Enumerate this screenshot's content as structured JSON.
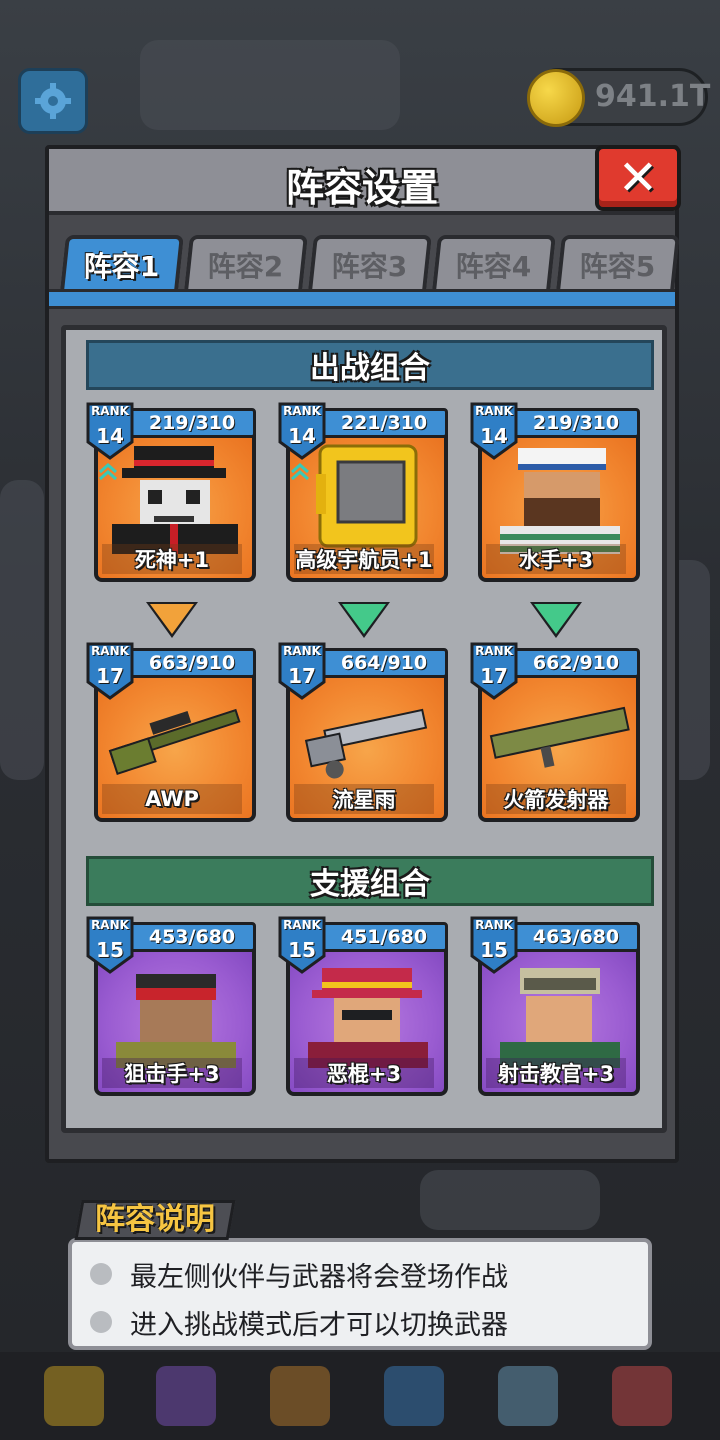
{
  "top": {
    "coin_value": "941.1T"
  },
  "panel": {
    "title": "阵容设置",
    "tabs": [
      "阵容1",
      "阵容2",
      "阵容3",
      "阵容4",
      "阵容5"
    ],
    "active_tab": 0,
    "battle_section_title": "出战组合",
    "support_section_title": "支援组合"
  },
  "battle_characters": [
    {
      "rank_label": "RANK",
      "rank": "14",
      "progress": "219/310",
      "name": "死神+1"
    },
    {
      "rank_label": "RANK",
      "rank": "14",
      "progress": "221/310",
      "name": "高级宇航员+1"
    },
    {
      "rank_label": "RANK",
      "rank": "14",
      "progress": "219/310",
      "name": "水手+3"
    }
  ],
  "weapons": [
    {
      "rank_label": "RANK",
      "rank": "17",
      "progress": "663/910",
      "name": "AWP"
    },
    {
      "rank_label": "RANK",
      "rank": "17",
      "progress": "664/910",
      "name": "流星雨"
    },
    {
      "rank_label": "RANK",
      "rank": "17",
      "progress": "662/910",
      "name": "火箭发射器"
    }
  ],
  "support_characters": [
    {
      "rank_label": "RANK",
      "rank": "15",
      "progress": "453/680",
      "name": "狙击手+3"
    },
    {
      "rank_label": "RANK",
      "rank": "15",
      "progress": "451/680",
      "name": "恶棍+3"
    },
    {
      "rank_label": "RANK",
      "rank": "15",
      "progress": "463/680",
      "name": "射击教官+3"
    }
  ],
  "description": {
    "title": "阵容说明",
    "items": [
      "最左侧伙伴与武器将会登场作战",
      "进入挑战模式后才可以切换武器"
    ]
  },
  "colors": {
    "accent_blue": "#3e8fd4",
    "close_red": "#e03a2e",
    "card_orange": "#f28730",
    "card_purple": "#9a5cd1"
  }
}
